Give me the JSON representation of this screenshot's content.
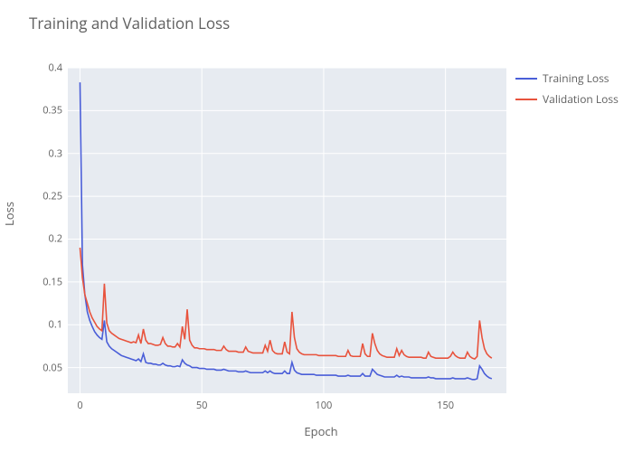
{
  "chart_data": {
    "type": "line",
    "title": "Training and Validation Loss",
    "xlabel": "Epoch",
    "ylabel": "Loss",
    "xlim": [
      -5,
      175
    ],
    "ylim": [
      0.02,
      0.4
    ],
    "x_ticks": [
      0,
      50,
      100,
      150
    ],
    "y_ticks": [
      0.05,
      0.1,
      0.15,
      0.2,
      0.25,
      0.3,
      0.35,
      0.4
    ],
    "legend_position": "right",
    "grid": true,
    "x": [
      0,
      1,
      2,
      3,
      4,
      5,
      6,
      7,
      8,
      9,
      10,
      11,
      12,
      13,
      14,
      15,
      16,
      17,
      18,
      19,
      20,
      21,
      22,
      23,
      24,
      25,
      26,
      27,
      28,
      29,
      30,
      31,
      32,
      33,
      34,
      35,
      36,
      37,
      38,
      39,
      40,
      41,
      42,
      43,
      44,
      45,
      46,
      47,
      48,
      49,
      50,
      51,
      52,
      53,
      54,
      55,
      56,
      57,
      58,
      59,
      60,
      61,
      62,
      63,
      64,
      65,
      66,
      67,
      68,
      69,
      70,
      71,
      72,
      73,
      74,
      75,
      76,
      77,
      78,
      79,
      80,
      81,
      82,
      83,
      84,
      85,
      86,
      87,
      88,
      89,
      90,
      91,
      92,
      93,
      94,
      95,
      96,
      97,
      98,
      99,
      100,
      101,
      102,
      103,
      104,
      105,
      106,
      107,
      108,
      109,
      110,
      111,
      112,
      113,
      114,
      115,
      116,
      117,
      118,
      119,
      120,
      121,
      122,
      123,
      124,
      125,
      126,
      127,
      128,
      129,
      130,
      131,
      132,
      133,
      134,
      135,
      136,
      137,
      138,
      139,
      140,
      141,
      142,
      143,
      144,
      145,
      146,
      147,
      148,
      149,
      150,
      151,
      152,
      153,
      154,
      155,
      156,
      157,
      158,
      159,
      160,
      161,
      162,
      163,
      164,
      165,
      166,
      167,
      168,
      169
    ],
    "series": [
      {
        "name": "Training Loss",
        "color": "#4a5ed8",
        "values": [
          0.383,
          0.17,
          0.135,
          0.115,
          0.105,
          0.098,
          0.092,
          0.088,
          0.085,
          0.083,
          0.105,
          0.08,
          0.075,
          0.072,
          0.07,
          0.068,
          0.066,
          0.064,
          0.063,
          0.062,
          0.061,
          0.06,
          0.059,
          0.058,
          0.06,
          0.057,
          0.066,
          0.056,
          0.055,
          0.055,
          0.054,
          0.054,
          0.053,
          0.053,
          0.055,
          0.053,
          0.052,
          0.052,
          0.051,
          0.051,
          0.052,
          0.051,
          0.059,
          0.055,
          0.053,
          0.052,
          0.05,
          0.05,
          0.05,
          0.049,
          0.049,
          0.049,
          0.048,
          0.048,
          0.048,
          0.048,
          0.047,
          0.047,
          0.047,
          0.048,
          0.047,
          0.046,
          0.046,
          0.046,
          0.046,
          0.045,
          0.045,
          0.045,
          0.046,
          0.045,
          0.044,
          0.044,
          0.044,
          0.044,
          0.044,
          0.044,
          0.046,
          0.044,
          0.046,
          0.044,
          0.043,
          0.043,
          0.043,
          0.043,
          0.046,
          0.043,
          0.043,
          0.056,
          0.047,
          0.044,
          0.043,
          0.042,
          0.042,
          0.042,
          0.042,
          0.042,
          0.042,
          0.041,
          0.041,
          0.041,
          0.041,
          0.041,
          0.041,
          0.041,
          0.041,
          0.041,
          0.04,
          0.04,
          0.04,
          0.04,
          0.041,
          0.04,
          0.04,
          0.04,
          0.04,
          0.04,
          0.043,
          0.04,
          0.04,
          0.04,
          0.048,
          0.045,
          0.042,
          0.041,
          0.04,
          0.039,
          0.039,
          0.039,
          0.039,
          0.039,
          0.041,
          0.039,
          0.04,
          0.039,
          0.039,
          0.039,
          0.038,
          0.038,
          0.038,
          0.038,
          0.038,
          0.038,
          0.038,
          0.039,
          0.038,
          0.038,
          0.037,
          0.037,
          0.037,
          0.037,
          0.037,
          0.037,
          0.037,
          0.038,
          0.037,
          0.037,
          0.037,
          0.037,
          0.037,
          0.038,
          0.037,
          0.036,
          0.036,
          0.037,
          0.052,
          0.048,
          0.043,
          0.04,
          0.038,
          0.037
        ]
      },
      {
        "name": "Validation Loss",
        "color": "#e8533d",
        "values": [
          0.19,
          0.155,
          0.135,
          0.125,
          0.115,
          0.108,
          0.103,
          0.098,
          0.095,
          0.093,
          0.148,
          0.102,
          0.093,
          0.09,
          0.088,
          0.086,
          0.084,
          0.083,
          0.082,
          0.081,
          0.08,
          0.079,
          0.08,
          0.079,
          0.088,
          0.078,
          0.095,
          0.082,
          0.078,
          0.078,
          0.077,
          0.076,
          0.076,
          0.077,
          0.085,
          0.078,
          0.075,
          0.075,
          0.074,
          0.074,
          0.078,
          0.074,
          0.098,
          0.083,
          0.118,
          0.082,
          0.076,
          0.073,
          0.073,
          0.072,
          0.072,
          0.072,
          0.071,
          0.071,
          0.071,
          0.071,
          0.07,
          0.07,
          0.07,
          0.075,
          0.071,
          0.069,
          0.069,
          0.069,
          0.069,
          0.068,
          0.068,
          0.068,
          0.074,
          0.069,
          0.068,
          0.067,
          0.067,
          0.067,
          0.067,
          0.067,
          0.076,
          0.069,
          0.082,
          0.07,
          0.067,
          0.066,
          0.066,
          0.066,
          0.08,
          0.068,
          0.066,
          0.115,
          0.085,
          0.072,
          0.068,
          0.066,
          0.065,
          0.065,
          0.065,
          0.065,
          0.065,
          0.065,
          0.064,
          0.064,
          0.064,
          0.064,
          0.064,
          0.064,
          0.064,
          0.064,
          0.063,
          0.063,
          0.063,
          0.063,
          0.07,
          0.064,
          0.063,
          0.063,
          0.063,
          0.063,
          0.078,
          0.066,
          0.063,
          0.063,
          0.09,
          0.078,
          0.07,
          0.066,
          0.064,
          0.063,
          0.062,
          0.062,
          0.062,
          0.062,
          0.072,
          0.064,
          0.07,
          0.065,
          0.063,
          0.062,
          0.062,
          0.062,
          0.062,
          0.062,
          0.062,
          0.061,
          0.061,
          0.068,
          0.063,
          0.062,
          0.061,
          0.061,
          0.061,
          0.061,
          0.061,
          0.061,
          0.063,
          0.068,
          0.064,
          0.062,
          0.061,
          0.061,
          0.061,
          0.068,
          0.063,
          0.061,
          0.06,
          0.063,
          0.105,
          0.085,
          0.072,
          0.066,
          0.063,
          0.061
        ]
      }
    ]
  }
}
